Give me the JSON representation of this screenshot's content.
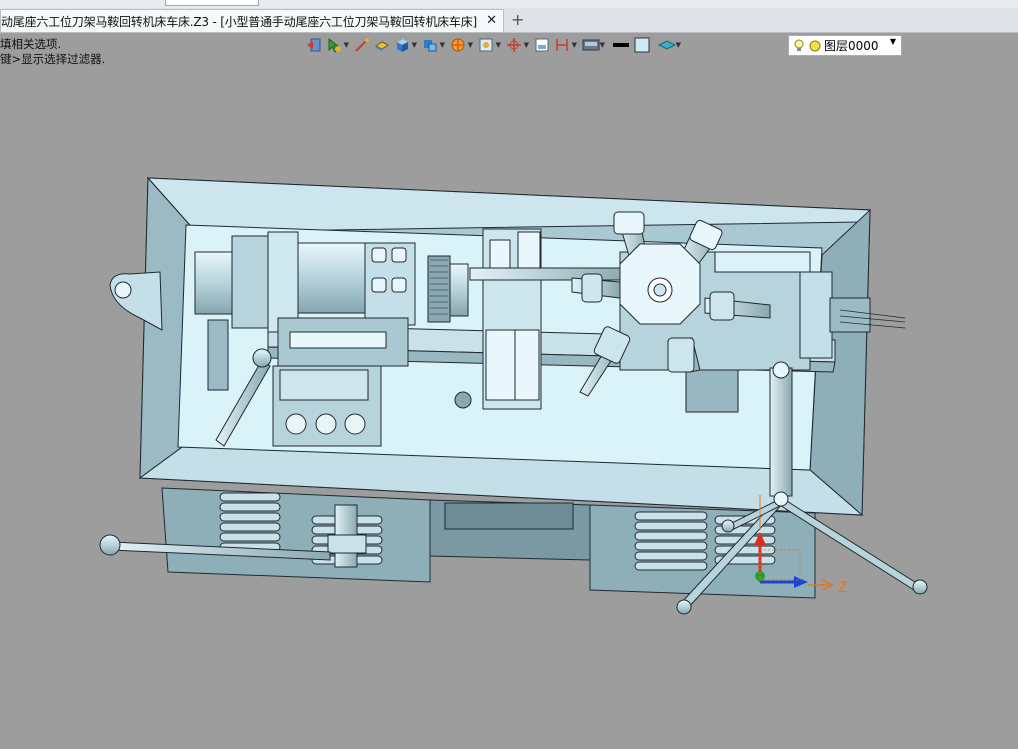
{
  "window": {
    "tab_title": "动尾座六工位刀架马鞍回转机床车床.Z3 - [小型普通手动尾座六工位刀架马鞍回转机床车床]",
    "tab_close": "✕",
    "tab_add": "+"
  },
  "prompt": {
    "line1": "填相关选项.",
    "line2": "键>显示选择过滤器."
  },
  "toolbar": {
    "icons": [
      "exit-icon",
      "pointer-icon",
      "sketch-icon",
      "face-icon",
      "cube-icon",
      "solid-icon",
      "render-icon",
      "view-icon",
      "orient-icon",
      "section-icon",
      "dimension-icon",
      "display-icon",
      "line-color-icon",
      "fill-color-icon",
      "layer-visibility-icon"
    ]
  },
  "layer": {
    "label": "图层0000"
  },
  "axis": {
    "z_label": "Z"
  },
  "colors": {
    "background": "#9d9d9d",
    "model_face": "#b6d3dc",
    "model_light": "#d9f1f7",
    "model_dark": "#7c9aa3",
    "edge": "#1f2a30"
  }
}
